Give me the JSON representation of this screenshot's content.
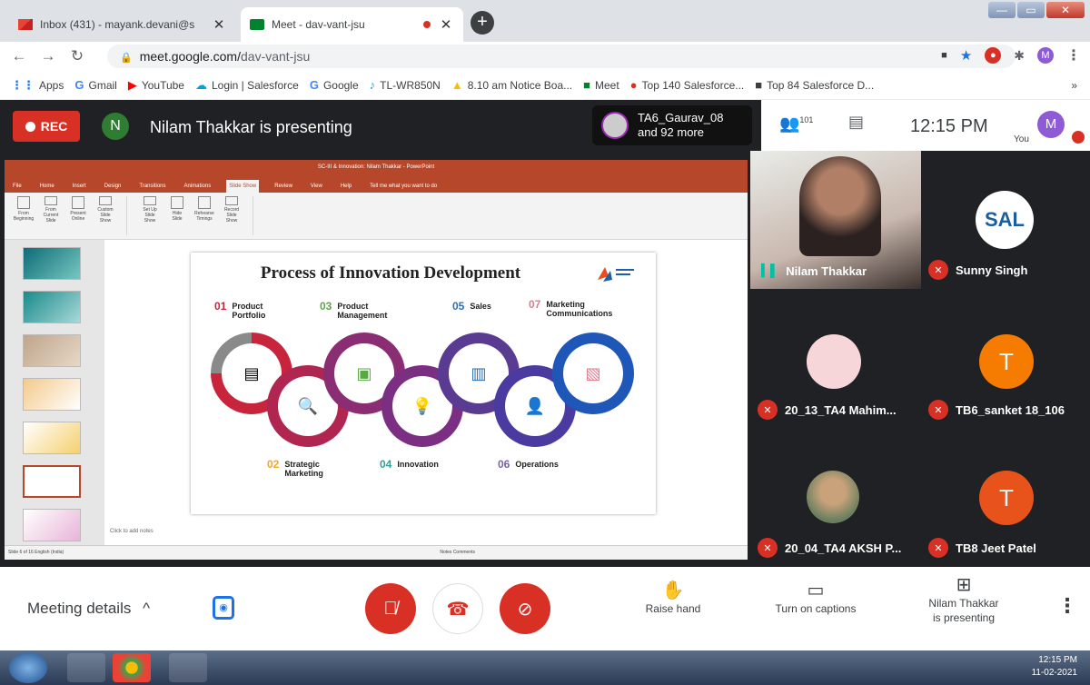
{
  "browser": {
    "tabs": [
      {
        "title": "Inbox (431) - mayank.devani@s",
        "close": "✕",
        "favicon": "gmail-icon"
      },
      {
        "title": "Meet - dav-vant-jsu",
        "close": "✕",
        "favicon": "meet-icon"
      }
    ],
    "new_tab": "+",
    "window_controls": {
      "min": "—",
      "max": "▭",
      "close": "✕"
    },
    "url_host": "meet.google.com/",
    "url_path": "dav-vant-jsu",
    "bookmarks": [
      {
        "label": "Apps",
        "icon": "apps-icon",
        "color": "#1a73e8"
      },
      {
        "label": "Gmail",
        "icon": "google-icon",
        "color": "#4285f4"
      },
      {
        "label": "YouTube",
        "icon": "youtube-icon",
        "color": "#ff0000"
      },
      {
        "label": "Login | Salesforce",
        "icon": "salesforce-icon",
        "color": "#00a1e0"
      },
      {
        "label": "Google",
        "icon": "google-icon",
        "color": "#4285f4"
      },
      {
        "label": "TL-WR850N",
        "icon": "tplink-icon",
        "color": "#2aa0d4"
      },
      {
        "label": "8.10 am Notice Boa...",
        "icon": "drive-icon",
        "color": "#fbbc04"
      },
      {
        "label": "Meet",
        "icon": "meet-icon",
        "color": "#00832d"
      },
      {
        "label": "Top 140 Salesforce...",
        "icon": "web-icon",
        "color": "#d93025"
      },
      {
        "label": "Top 84 Salesforce D...",
        "icon": "web-icon",
        "color": "#3c4043"
      }
    ],
    "bookmarks_more": "»"
  },
  "meet": {
    "rec_label": "REC",
    "presenter_initial": "N",
    "presenting_text": "Nilam Thakkar is presenting",
    "others_line1": "TA6_Gaurav_08",
    "others_line2": "and 92 more",
    "people_count": "101",
    "time": "12:15 PM",
    "you_label": "You",
    "user_initial": "M",
    "participants": [
      {
        "name": "Nilam Thakkar",
        "initial": "",
        "color": "#d9c9c0"
      },
      {
        "name": "Sunny Singh",
        "initial": "SAL",
        "color": "#1b5e9e"
      },
      {
        "name": "20_13_TA4 Mahim...",
        "initial": "",
        "color": "#f6d6d9"
      },
      {
        "name": "TB6_sanket 18_106",
        "initial": "T",
        "color": "#f57c00"
      },
      {
        "name": "20_04_TA4 AKSH P...",
        "initial": "",
        "color": "#c9b79c"
      },
      {
        "name": "TB8 Jeet Patel",
        "initial": "T",
        "color": "#e8531c"
      }
    ],
    "meeting_details": "Meeting details",
    "meeting_details_chevron": "^",
    "raise_hand": "Raise hand",
    "captions": "Turn on captions",
    "presenting_btn_line1": "Nilam Thakkar",
    "presenting_btn_line2": "is presenting",
    "accent_red": "#d93025"
  },
  "ppt": {
    "title_bar": "SC-III & Innovation: Nilam Thakkar  -  PowerPoint",
    "menu": [
      "File",
      "Home",
      "Insert",
      "Design",
      "Transitions",
      "Animations",
      "Slide Show",
      "Review",
      "View",
      "Help",
      "Tell me what you want to do"
    ],
    "active_menu": "Slide Show",
    "ribbon_buttons": [
      "From Beginning",
      "From Current Slide",
      "Present Online",
      "Custom Slide Show",
      "Set Up Slide Show",
      "Hide Slide",
      "Rehearse Timings",
      "Record Slide Show"
    ],
    "slide_title": "Process of Innovation Development",
    "steps_top": [
      {
        "num": "01",
        "label": "Product Portfolio",
        "color": "#c8243b"
      },
      {
        "num": "03",
        "label": "Product Management",
        "color": "#5aa845"
      },
      {
        "num": "05",
        "label": "Sales",
        "color": "#2a6fb8"
      },
      {
        "num": "07",
        "label": "Marketing Communications",
        "color": "#e37a8e"
      }
    ],
    "steps_bottom": [
      {
        "num": "02",
        "label": "Strategic Marketing",
        "color": "#f4a623"
      },
      {
        "num": "04",
        "label": "Innovation",
        "color": "#2aa39a"
      },
      {
        "num": "06",
        "label": "Operations",
        "color": "#7b5fb1"
      }
    ],
    "ring_colors": [
      "#c8243b",
      "#b12650",
      "#8a2d72",
      "#7a2f82",
      "#5a3b92",
      "#4b3aa0",
      "#1e57b8"
    ],
    "ring_icons": [
      "▤",
      "🔍",
      "▣",
      "💡",
      "▥",
      "👤",
      "▧"
    ],
    "notes": "Click to add notes",
    "status_left": "Slide 6 of 16    English (India)",
    "status_right": "Notes   Comments"
  },
  "taskbar": {
    "time": "12:15 PM",
    "date": "11-02-2021"
  }
}
